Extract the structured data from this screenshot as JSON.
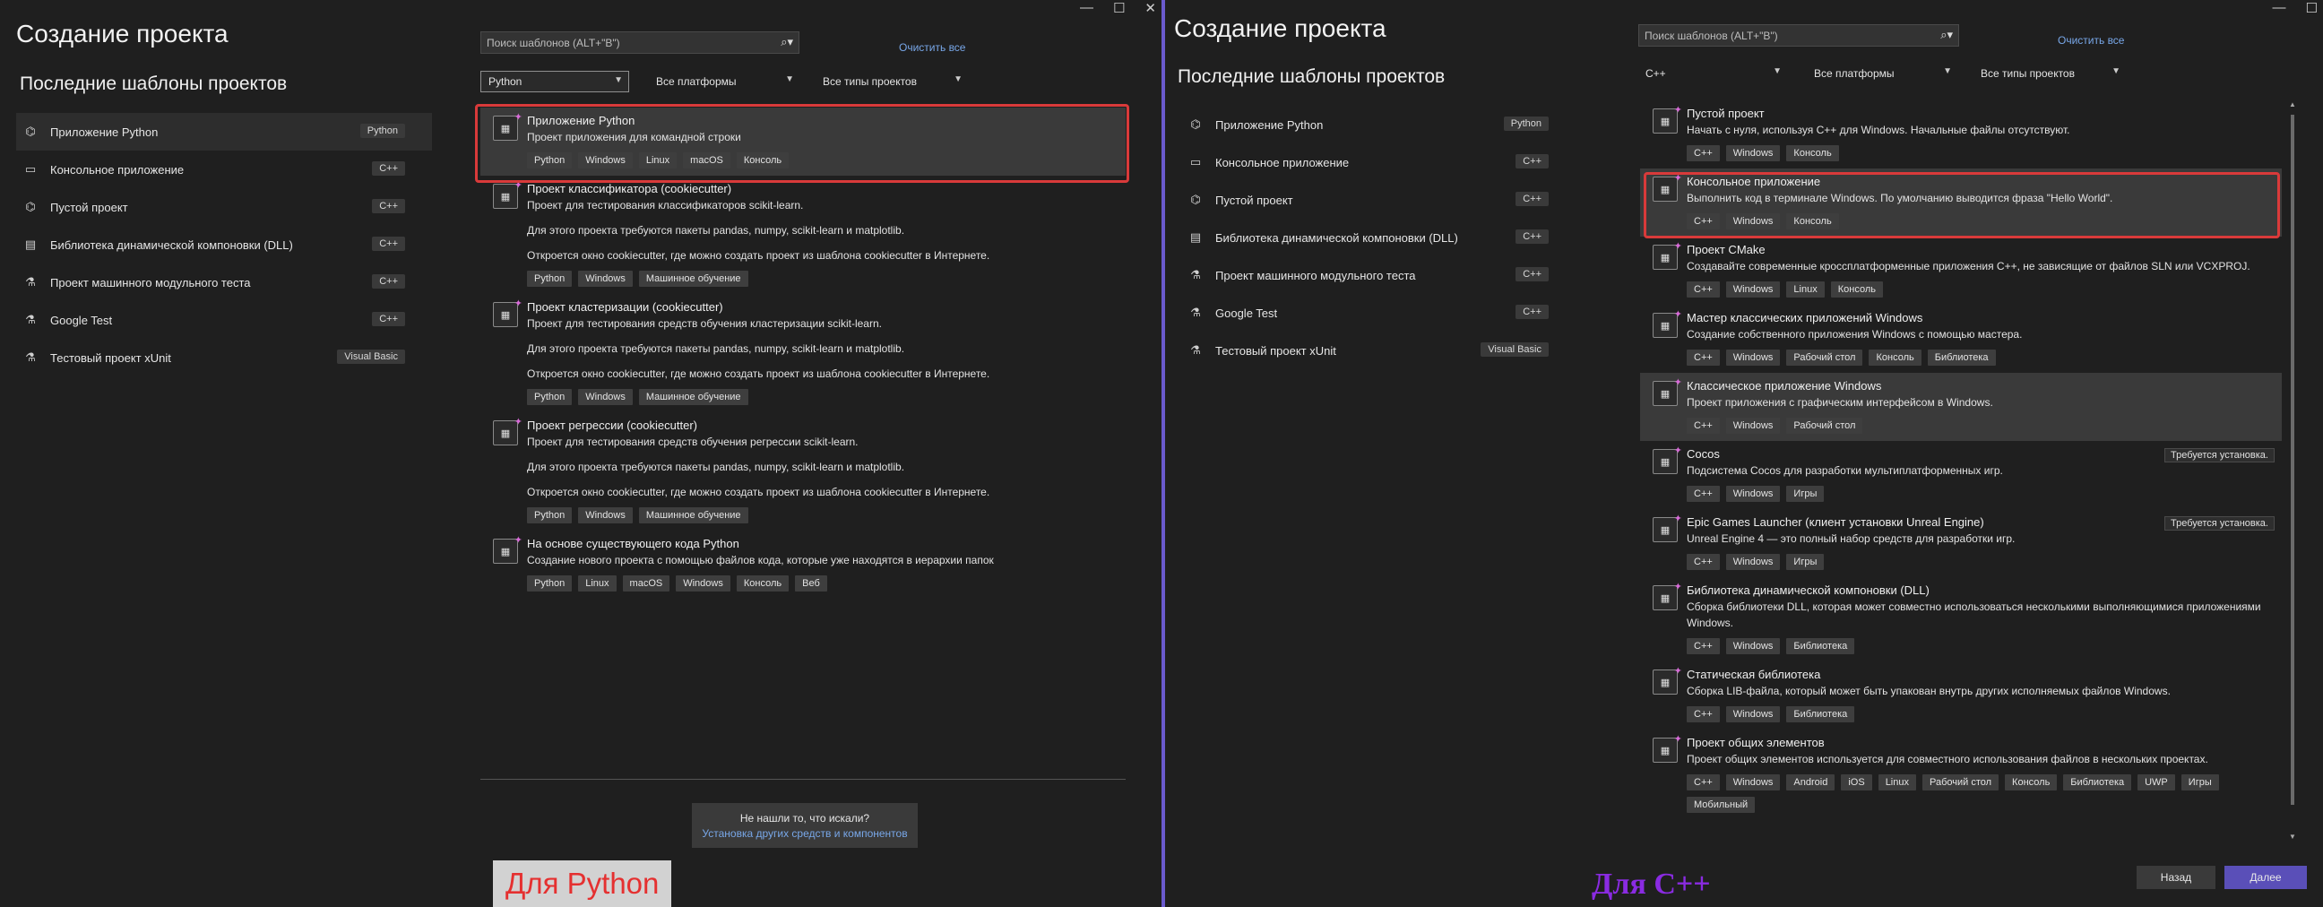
{
  "left": {
    "title": "Создание проекта",
    "recent_heading": "Последние шаблоны проектов",
    "recent": [
      {
        "label": "Приложение Python",
        "badge": "Python",
        "icon": "python-app-icon"
      },
      {
        "label": "Консольное приложение",
        "badge": "C++",
        "icon": "console-icon"
      },
      {
        "label": "Пустой проект",
        "badge": "C++",
        "icon": "empty-project-icon"
      },
      {
        "label": "Библиотека динамической компоновки (DLL)",
        "badge": "C++",
        "icon": "dll-icon"
      },
      {
        "label": "Проект машинного модульного теста",
        "badge": "C++",
        "icon": "test-flask-icon"
      },
      {
        "label": "Google Test",
        "badge": "C++",
        "icon": "test-flask-icon"
      },
      {
        "label": "Тестовый проект xUnit",
        "badge": "Visual Basic",
        "icon": "test-flask-icon"
      }
    ],
    "search_placeholder": "Поиск шаблонов (ALT+\"В\")",
    "clear_all": "Очистить все",
    "filters": {
      "language": "Python",
      "platform": "Все платформы",
      "type": "Все типы проектов"
    },
    "templates": [
      {
        "title": "Приложение Python",
        "desc": "Проект приложения для командной строки",
        "notes": [],
        "tags": [
          "Python",
          "Windows",
          "Linux",
          "macOS",
          "Консоль"
        ]
      },
      {
        "title": "Проект классификатора (cookiecutter)",
        "desc": "Проект для тестирования классификаторов scikit-learn.",
        "notes": [
          "Для этого проекта требуются пакеты pandas, numpy, scikit-learn и matplotlib.",
          "Откроется окно cookiecutter, где можно создать проект из шаблона cookiecutter в Интернете."
        ],
        "tags": [
          "Python",
          "Windows",
          "Машинное обучение"
        ]
      },
      {
        "title": "Проект кластеризации (cookiecutter)",
        "desc": "Проект для тестирования средств обучения кластеризации scikit-learn.",
        "notes": [
          "Для этого проекта требуются пакеты pandas, numpy, scikit-learn и matplotlib.",
          "Откроется окно cookiecutter, где можно создать проект из шаблона cookiecutter в Интернете."
        ],
        "tags": [
          "Python",
          "Windows",
          "Машинное обучение"
        ]
      },
      {
        "title": "Проект регрессии (cookiecutter)",
        "desc": "Проект для тестирования средств обучения регрессии scikit-learn.",
        "notes": [
          "Для этого проекта требуются пакеты pandas, numpy, scikit-learn и matplotlib.",
          "Откроется окно cookiecutter, где можно создать проект из шаблона cookiecutter в Интернете."
        ],
        "tags": [
          "Python",
          "Windows",
          "Машинное обучение"
        ]
      },
      {
        "title": "На основе существующего кода Python",
        "desc": "Создание нового проекта с помощью файлов кода, которые уже находятся в иерархии папок",
        "notes": [],
        "tags": [
          "Python",
          "Linux",
          "macOS",
          "Windows",
          "Консоль",
          "Веб"
        ]
      }
    ],
    "not_found": "Не нашли то, что искали?",
    "install_link": "Установка других средств и компонентов",
    "caption": "Для Python"
  },
  "right": {
    "title": "Создание проекта",
    "recent_heading": "Последние шаблоны проектов",
    "recent": [
      {
        "label": "Приложение Python",
        "badge": "Python",
        "icon": "python-app-icon"
      },
      {
        "label": "Консольное приложение",
        "badge": "C++",
        "icon": "console-icon"
      },
      {
        "label": "Пустой проект",
        "badge": "C++",
        "icon": "empty-project-icon"
      },
      {
        "label": "Библиотека динамической компоновки (DLL)",
        "badge": "C++",
        "icon": "dll-icon"
      },
      {
        "label": "Проект машинного модульного теста",
        "badge": "C++",
        "icon": "test-flask-icon"
      },
      {
        "label": "Google Test",
        "badge": "C++",
        "icon": "test-flask-icon"
      },
      {
        "label": "Тестовый проект xUnit",
        "badge": "Visual Basic",
        "icon": "test-flask-icon"
      }
    ],
    "search_placeholder": "Поиск шаблонов (ALT+\"В\")",
    "clear_all": "Очистить все",
    "filters": {
      "language": "C++",
      "platform": "Все платформы",
      "type": "Все типы проектов"
    },
    "templates": [
      {
        "title": "Пустой проект",
        "desc": "Начать с нуля, используя C++ для Windows. Начальные файлы отсутствуют.",
        "tags": [
          "C++",
          "Windows",
          "Консоль"
        ],
        "req": ""
      },
      {
        "title": "Консольное приложение",
        "desc": "Выполнить код в терминале Windows. По умолчанию выводится фраза \"Hello World\".",
        "tags": [
          "C++",
          "Windows",
          "Консоль"
        ],
        "req": ""
      },
      {
        "title": "Проект CMake",
        "desc": "Создавайте современные кроссплатформенные приложения C++, не зависящие от файлов SLN или VCXPROJ.",
        "tags": [
          "C++",
          "Windows",
          "Linux",
          "Консоль"
        ],
        "req": ""
      },
      {
        "title": "Мастер классических приложений Windows",
        "desc": "Создание собственного приложения Windows с помощью мастера.",
        "tags": [
          "C++",
          "Windows",
          "Рабочий стол",
          "Консоль",
          "Библиотека"
        ],
        "req": ""
      },
      {
        "title": "Классическое приложение Windows",
        "desc": "Проект приложения с графическим интерфейсом в Windows.",
        "tags": [
          "C++",
          "Windows",
          "Рабочий стол"
        ],
        "req": ""
      },
      {
        "title": "Cocos",
        "desc": "Подсистема Cocos для разработки мультиплатформенных игр.",
        "tags": [
          "C++",
          "Windows",
          "Игры"
        ],
        "req": "Требуется установка."
      },
      {
        "title": "Epic Games Launcher (клиент установки Unreal Engine)",
        "desc": "Unreal Engine 4 — это полный набор средств для разработки игр.",
        "tags": [
          "C++",
          "Windows",
          "Игры"
        ],
        "req": "Требуется установка."
      },
      {
        "title": "Библиотека динамической компоновки (DLL)",
        "desc": "Сборка библиотеки DLL, которая может совместно использоваться несколькими выполняющимися приложениями Windows.",
        "tags": [
          "C++",
          "Windows",
          "Библиотека"
        ],
        "req": ""
      },
      {
        "title": "Статическая библиотека",
        "desc": "Сборка LIB-файла, который может быть упакован внутрь других исполняемых файлов Windows.",
        "tags": [
          "C++",
          "Windows",
          "Библиотека"
        ],
        "req": ""
      },
      {
        "title": "Проект общих элементов",
        "desc": "Проект общих элементов используется для совместного использования файлов в нескольких проектах.",
        "tags": [
          "C++",
          "Windows",
          "Android",
          "iOS",
          "Linux",
          "Рабочий стол",
          "Консоль",
          "Библиотека",
          "UWP",
          "Игры",
          "Мобильный"
        ],
        "req": ""
      }
    ],
    "back": "Назад",
    "next": "Далее",
    "caption": "Для C++"
  }
}
